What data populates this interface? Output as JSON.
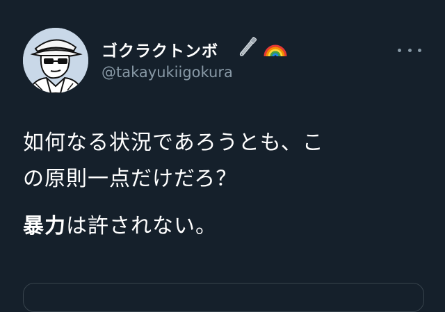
{
  "tweet": {
    "display_name": "ゴクラクトンボ",
    "handle": "@takayukiigokura",
    "body": {
      "line1": "如何なる状況であろうとも、こ",
      "line2": "の原則一点だけだろ？",
      "line3_bold": "暴力",
      "line3_rest": "は許されない。"
    },
    "icons": {
      "badge1": "safety-pin-icon",
      "badge2": "rainbow-icon",
      "menu": "more-dots-icon"
    }
  },
  "colors": {
    "background": "#15202b",
    "text_primary": "#ffffff",
    "text_secondary": "#8899a6",
    "border": "#38444d"
  }
}
